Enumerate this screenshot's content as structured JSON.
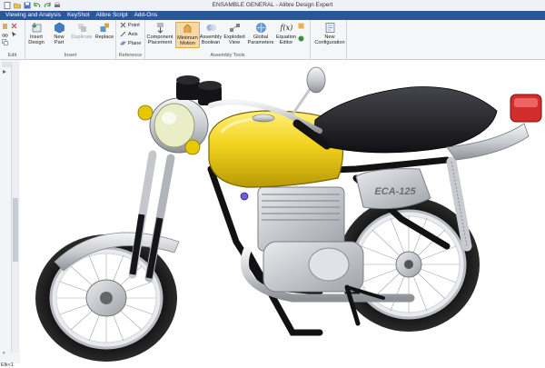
{
  "window": {
    "title": "ENSAMBLE GENERAL - Alibre Design Expert"
  },
  "quick_access": {
    "icons": [
      "new-icon",
      "open-icon",
      "save-icon",
      "undo-icon",
      "redo-icon",
      "print-icon"
    ]
  },
  "menu": {
    "tabs": [
      "Viewing and Analysis",
      "KeyShot",
      "Alibre Script",
      "Add-Ons"
    ]
  },
  "ribbon": {
    "groups": {
      "edit": "Edit",
      "insert": "Insert",
      "reference": "Reference",
      "assembly_tools": "Assembly Tools"
    },
    "buttons": {
      "insert_design": "Insert\nDesign",
      "new_part": "New\nPart",
      "duplicate": "Duplicate",
      "replace": "Replace",
      "point": "Point",
      "axis": "Axis",
      "plane": "Plane",
      "component_placement": "Component\nPlacement",
      "minimum_motion": "Minimum\nMotion",
      "assembly_boolean": "Assembly\nBoolean",
      "exploded_view": "Exploded\nView",
      "global_parameters": "Global\nParameters",
      "equation_editor": "Equation\nEditor",
      "new_configuration": "New\nConfiguration"
    },
    "equation_glyph": "f(x)"
  },
  "left_panel": {
    "footer": "Elk<1"
  },
  "viewport": {
    "model": "motorcycle-3d-model",
    "tank_text": "ECA-125",
    "colors": {
      "tank": "#f2d21c",
      "seat": "#1e1e22",
      "frame": "#101012",
      "chrome": "#c9ccd0"
    }
  }
}
